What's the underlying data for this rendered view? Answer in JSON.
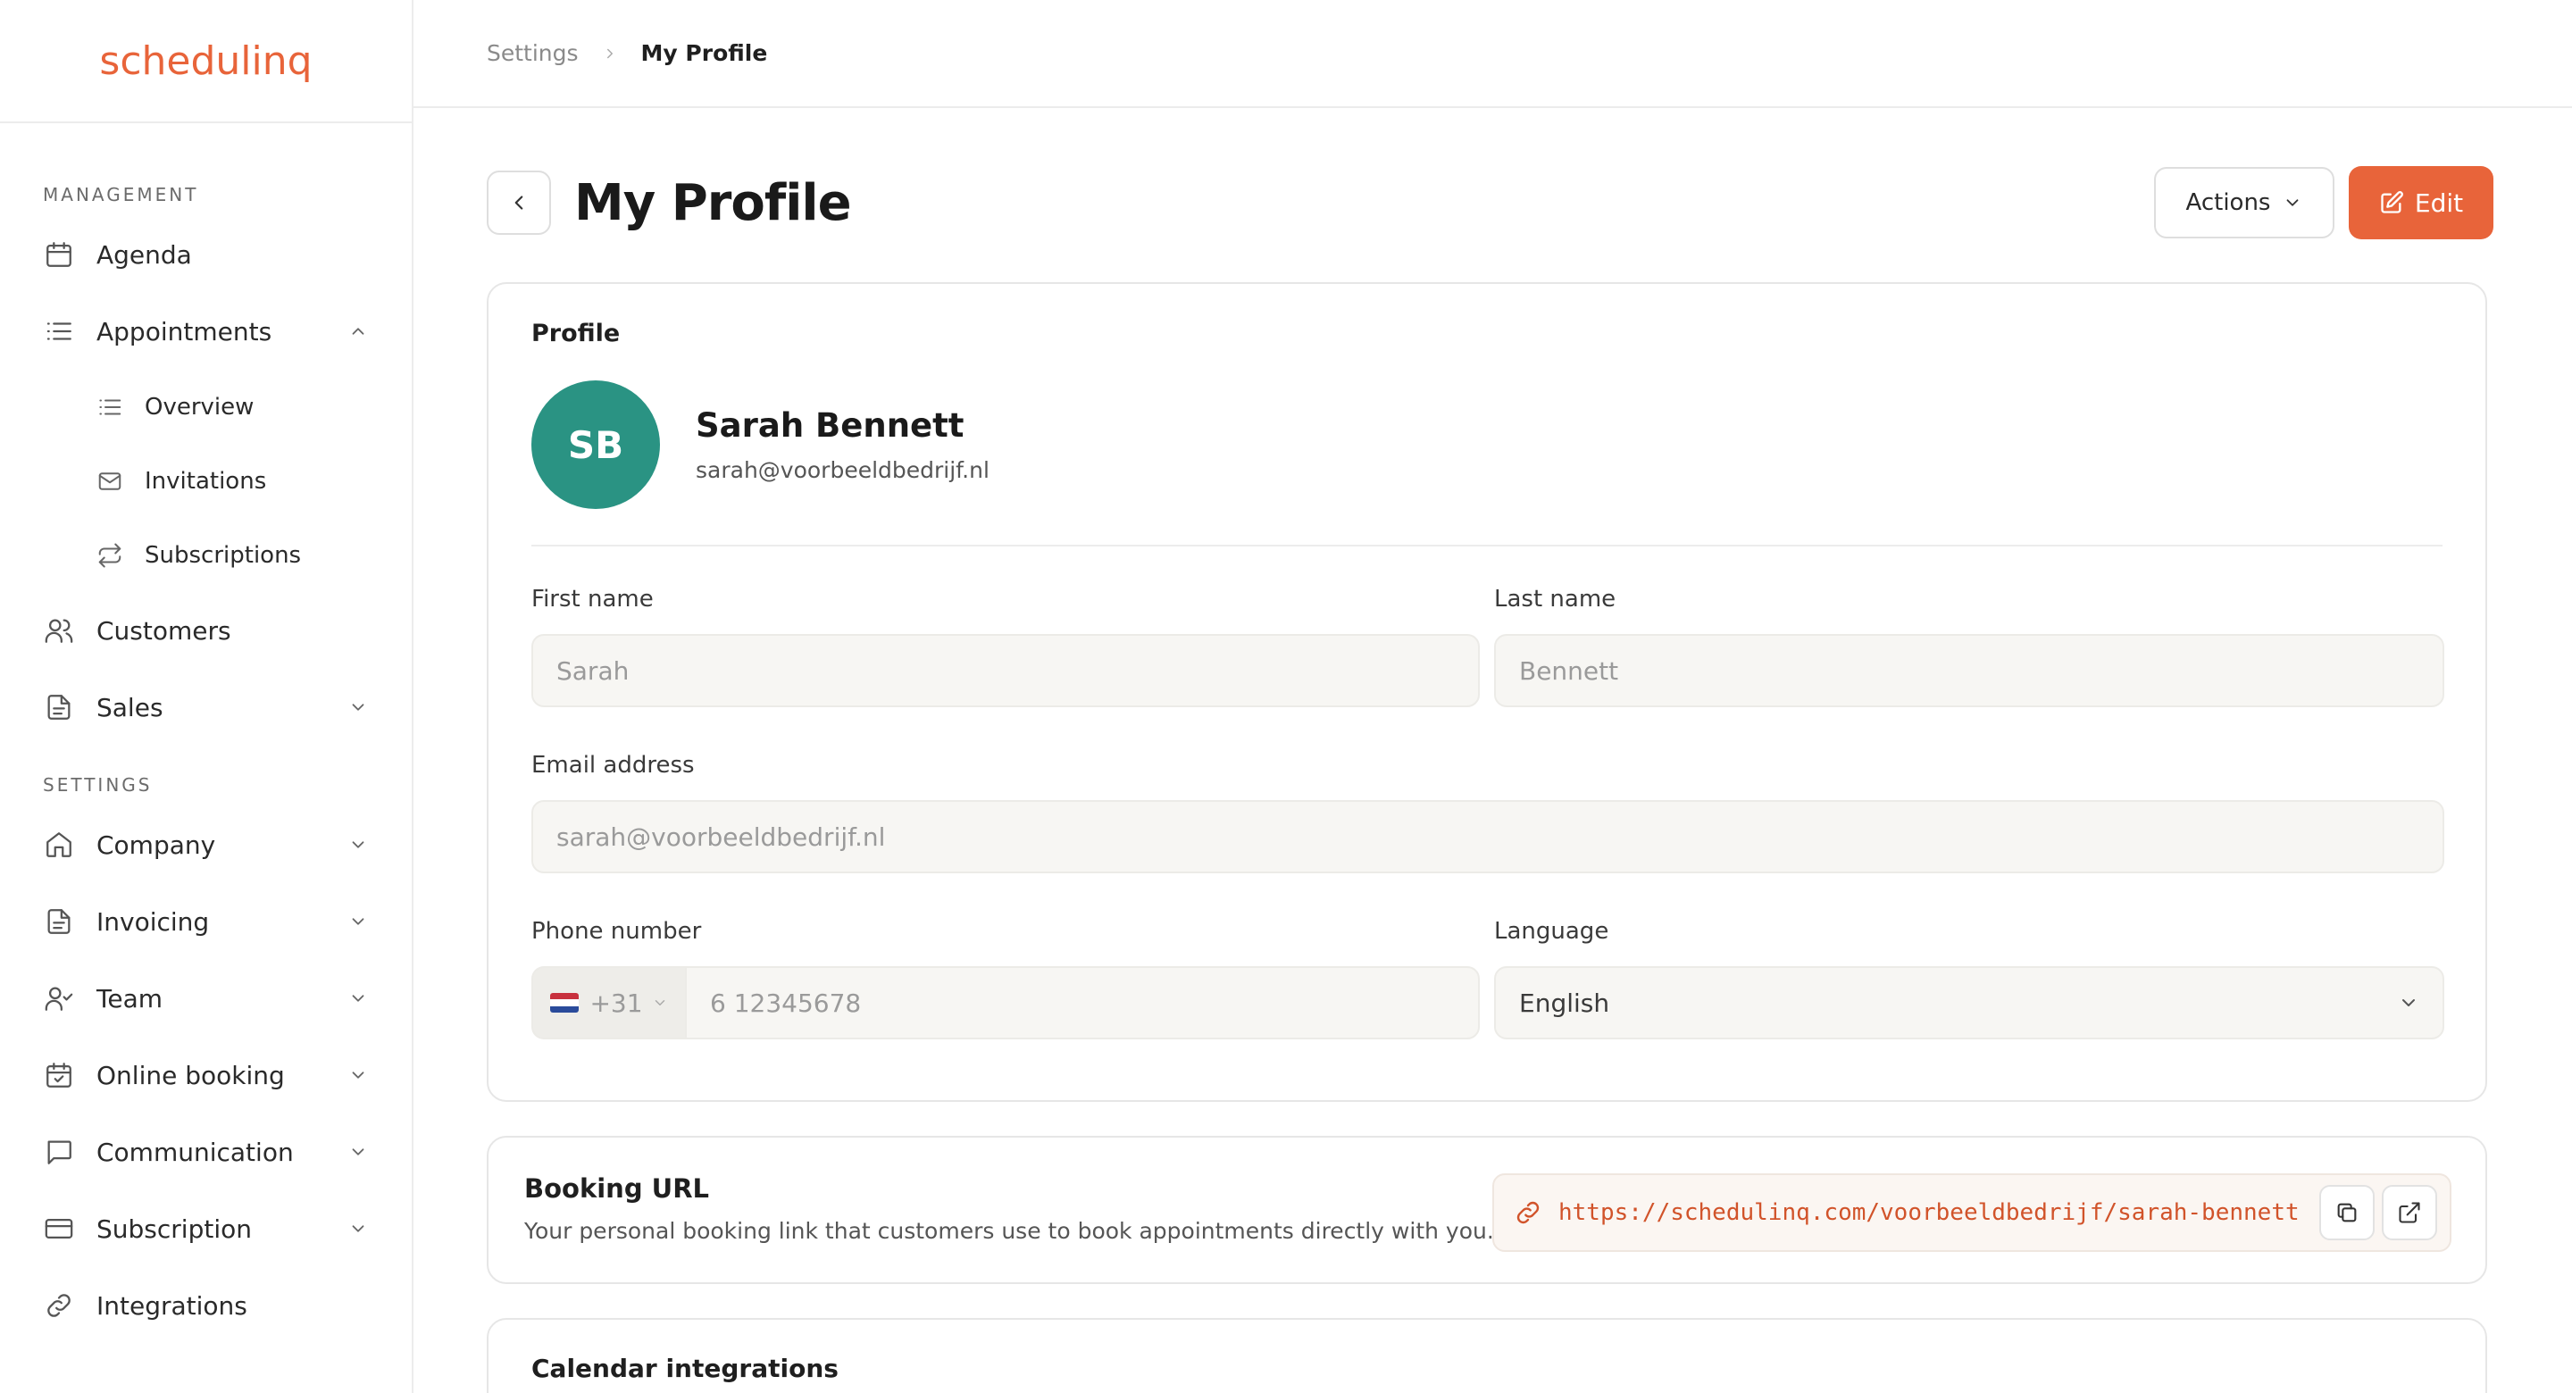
{
  "brand": {
    "logo": "schedulinq",
    "accent": "#e8643a"
  },
  "sidebar": {
    "management_label": "MANAGEMENT",
    "settings_label": "SETTINGS",
    "management_items": [
      {
        "label": "Agenda",
        "icon": "calendar-icon"
      },
      {
        "label": "Appointments",
        "icon": "list-icon",
        "expanded": true
      },
      {
        "label": "Customers",
        "icon": "users-icon"
      },
      {
        "label": "Sales",
        "icon": "document-icon"
      }
    ],
    "appointment_subitems": [
      {
        "label": "Overview",
        "icon": "list-icon"
      },
      {
        "label": "Invitations",
        "icon": "mail-icon"
      },
      {
        "label": "Subscriptions",
        "icon": "repeat-icon"
      }
    ],
    "settings_items": [
      {
        "label": "Company",
        "icon": "home-icon"
      },
      {
        "label": "Invoicing",
        "icon": "document-icon"
      },
      {
        "label": "Team",
        "icon": "user-check-icon"
      },
      {
        "label": "Online booking",
        "icon": "calendar-check-icon"
      },
      {
        "label": "Communication",
        "icon": "chat-icon"
      },
      {
        "label": "Subscription",
        "icon": "credit-card-icon"
      },
      {
        "label": "Integrations",
        "icon": "link-icon"
      }
    ]
  },
  "breadcrumb": {
    "parent": "Settings",
    "current": "My Profile"
  },
  "page": {
    "title": "My Profile",
    "actions_label": "Actions",
    "edit_label": "Edit"
  },
  "profile": {
    "section_title": "Profile",
    "initials": "SB",
    "avatar_color": "#2a9383",
    "name": "Sarah Bennett",
    "email": "sarah@voorbeeldbedrijf.nl",
    "fields": {
      "first_name_label": "First name",
      "first_name_value": "Sarah",
      "last_name_label": "Last name",
      "last_name_value": "Bennett",
      "email_label": "Email address",
      "email_value": "sarah@voorbeeldbedrijf.nl",
      "phone_label": "Phone number",
      "phone_prefix": "+31",
      "phone_value": "6 12345678",
      "language_label": "Language",
      "language_value": "English"
    }
  },
  "booking": {
    "title": "Booking URL",
    "description": "Your personal booking link that customers use to book appointments directly with you.",
    "url": "https://schedulinq.com/voorbeeldbedrijf/sarah-bennett"
  },
  "calendar": {
    "title": "Calendar integrations"
  }
}
